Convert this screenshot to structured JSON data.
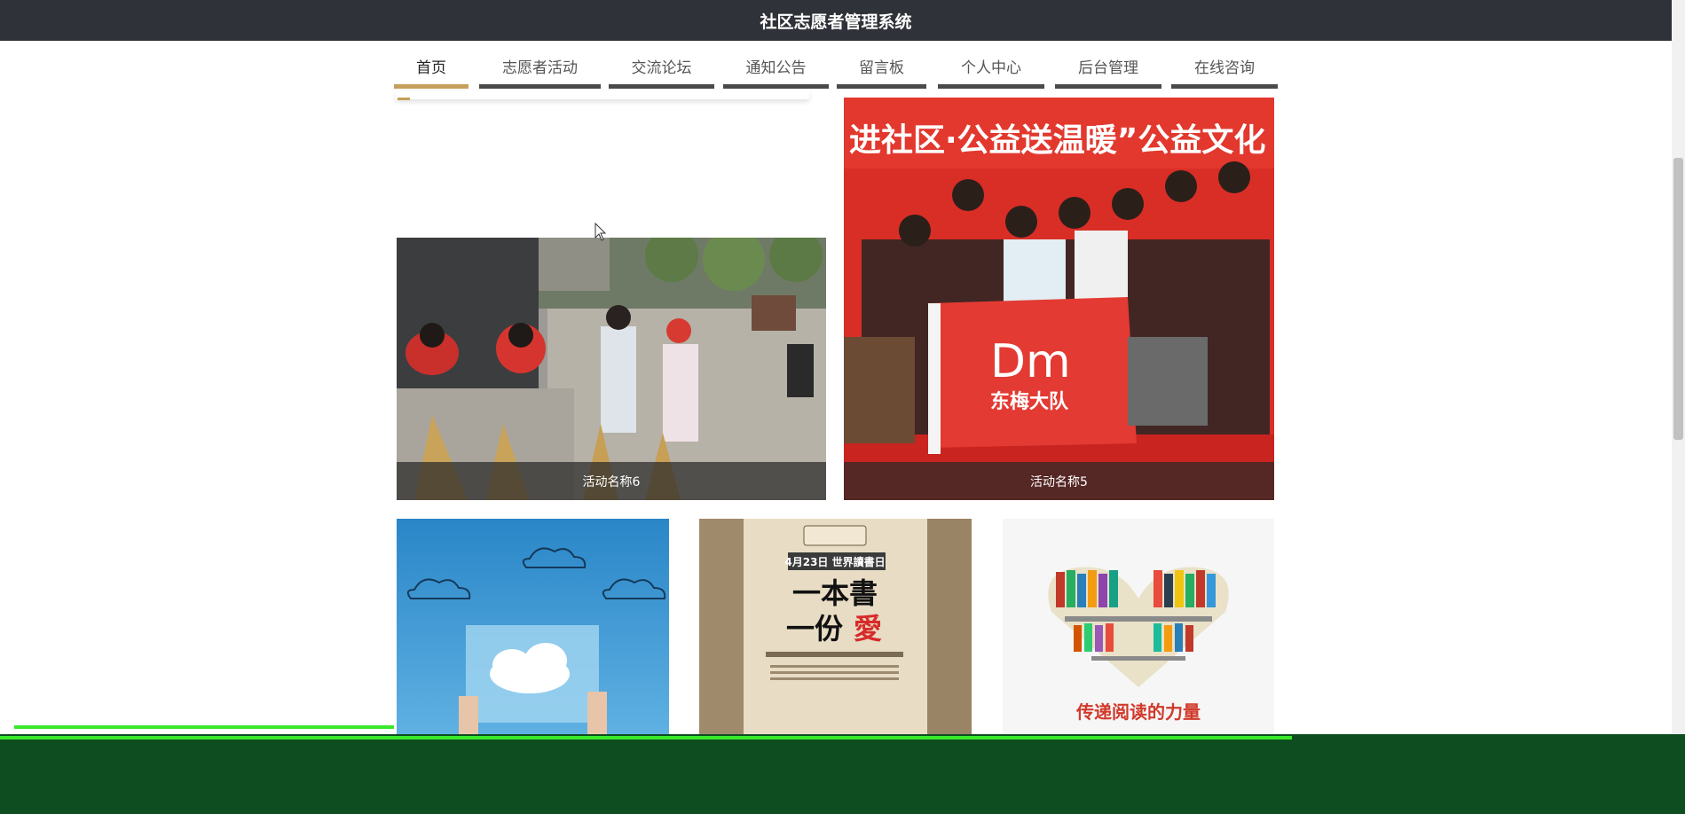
{
  "app": {
    "title": "社区志愿者管理系统"
  },
  "nav": {
    "items": [
      {
        "label": "首页",
        "active": true
      },
      {
        "label": "志愿者活动"
      },
      {
        "label": "交流论坛"
      },
      {
        "label": "通知公告"
      },
      {
        "label": "留言板"
      },
      {
        "label": "个人中心"
      },
      {
        "label": "后台管理"
      },
      {
        "label": "在线咨询"
      }
    ]
  },
  "activities": {
    "big": [
      {
        "caption": "活动名称6"
      },
      {
        "caption": "活动名称5"
      }
    ],
    "small": [
      {
        "image": "cloud-sign"
      },
      {
        "image": "reading-day-poster",
        "text": {
          "date": "4月23日 世界讀書日",
          "line1": "一本書",
          "line2a": "一份",
          "line2b": "愛"
        }
      },
      {
        "image": "book-heart",
        "text": "传递阅读的力量"
      }
    ],
    "banner_text": "进社区·公益送温暖”公益文化",
    "flag_text": {
      "logo": "Dm",
      "name": "东梅大队"
    }
  },
  "colors": {
    "topbar": "#2f3238",
    "accent": "#c4a05a",
    "nav_bar": "#4a4a4a",
    "caption_bg": "rgba(40,40,40,0.72)"
  }
}
